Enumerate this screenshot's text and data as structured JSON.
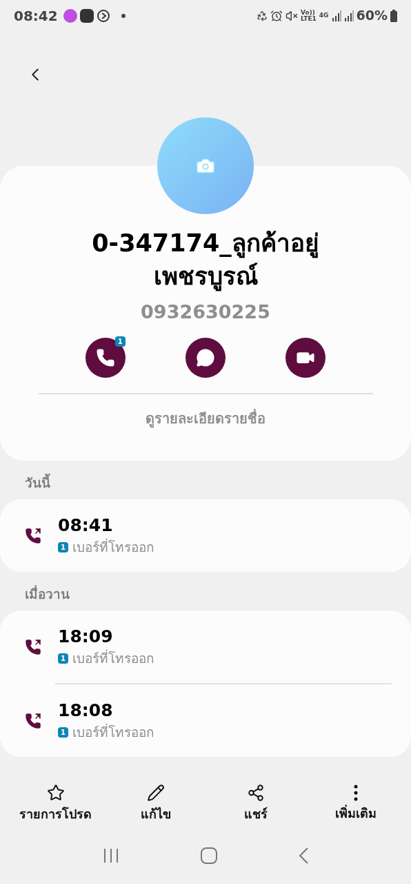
{
  "status_bar": {
    "time": "08:42",
    "volte": "Vo))",
    "lte": "LTE1",
    "network": "4G",
    "battery": "60%"
  },
  "contact": {
    "name": "0-347174_ลูกค้าอยู่เพชรบูรณ์",
    "phone": "0932630225",
    "link": "ดูรายละเอียดรายชื่อ"
  },
  "actions": [
    {
      "kind": "call",
      "badge": "1"
    },
    {
      "kind": "message"
    },
    {
      "kind": "video"
    }
  ],
  "history": [
    {
      "label": "วันนี้",
      "calls": [
        {
          "time": "08:41",
          "sim": "1",
          "type": "เบอร์ที่โทรออก"
        }
      ]
    },
    {
      "label": "เมื่อวาน",
      "calls": [
        {
          "time": "18:09",
          "sim": "1",
          "type": "เบอร์ที่โทรออก"
        },
        {
          "time": "18:08",
          "sim": "1",
          "type": "เบอร์ที่โทรออก"
        }
      ]
    }
  ],
  "toolbar": [
    {
      "kind": "favorite",
      "label": "รายการโปรด"
    },
    {
      "kind": "edit",
      "label": "แก้ไข"
    },
    {
      "kind": "share",
      "label": "แชร์"
    },
    {
      "kind": "more",
      "label": "เพิ่มเติม"
    }
  ]
}
